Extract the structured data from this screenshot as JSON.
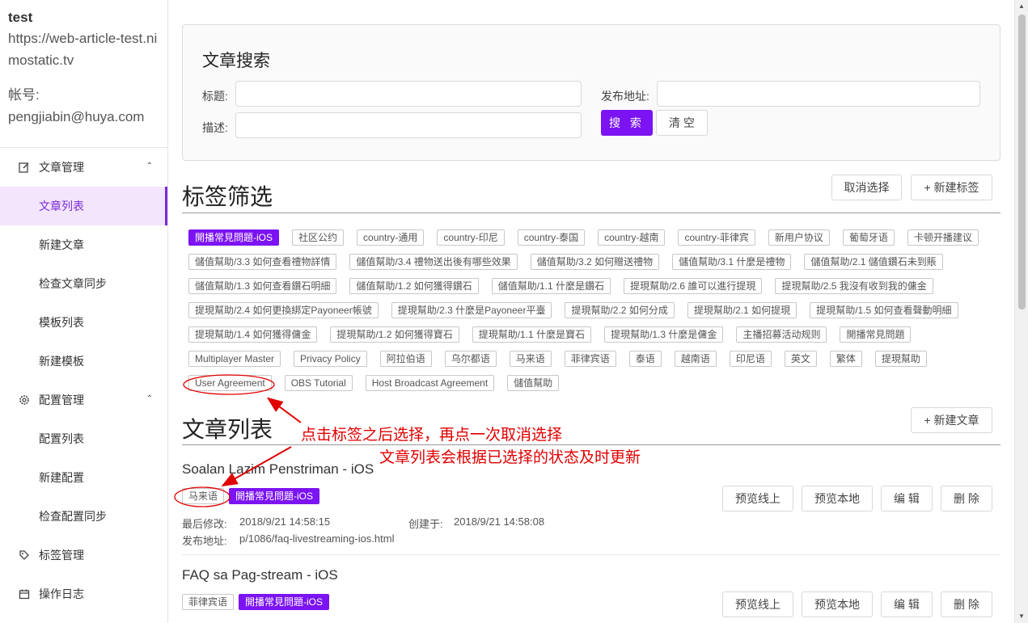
{
  "site": {
    "name": "test",
    "url": "https://web-article-test.nimostatic.tv",
    "account_label": "帐号:",
    "account_email": "pengjiabin@huya.com"
  },
  "menu": {
    "group1": "文章管理",
    "group1_items": [
      "文章列表",
      "新建文章",
      "检查文章同步",
      "模板列表",
      "新建模板"
    ],
    "group2": "配置管理",
    "group2_items": [
      "配置列表",
      "新建配置",
      "检查配置同步"
    ],
    "tags": "标签管理",
    "logs": "操作日志"
  },
  "search": {
    "title": "文章搜索",
    "title_label": "标题:",
    "desc_label": "描述:",
    "address_label": "发布地址:",
    "search_button": "搜 索",
    "clear_button": "清 空"
  },
  "tag_filter": {
    "title": "标签筛选",
    "cancel_button": "取消选择",
    "new_tag_button": "+ 新建标签",
    "rows": [
      [
        "開播常見問題-iOS",
        "社区公约",
        "country-通用",
        "country-印尼",
        "country-泰国",
        "country-越南",
        "country-菲律宾",
        "新用户协议",
        "葡萄牙语",
        "卡顿开播建议"
      ],
      [
        "儲值幫助/3.3 如何查看禮物詳情",
        "儲值幫助/3.4 禮物送出後有哪些效果",
        "儲值幫助/3.2 如何贈送禮物",
        "儲值幫助/3.1 什麼是禮物",
        "儲值幫助/2.1 儲值鑽石未到賬"
      ],
      [
        "儲值幫助/1.3 如何查看鑽石明細",
        "儲值幫助/1.2 如何獲得鑽石",
        "儲值幫助/1.1 什麼是鑽石",
        "提現幫助/2.6 誰可以進行提現",
        "提現幫助/2.5 我沒有收到我的傭金"
      ],
      [
        "提現幫助/2.4 如何更換綁定Payoneer帳號",
        "提現幫助/2.3 什麼是Payoneer平臺",
        "提現幫助/2.2 如何分成",
        "提現幫助/2.1 如何提現",
        "提現幫助/1.5 如何查看聲動明細"
      ],
      [
        "提現幫助/1.4 如何獲得傭金",
        "提現幫助/1.2 如何獲得寶石",
        "提現幫助/1.1 什麼是寶石",
        "提現幫助/1.3 什麼是傭金",
        "主播招募活动规则",
        "開播常見問題"
      ],
      [
        "Multiplayer Master",
        "Privacy Policy",
        "阿拉伯语",
        "乌尔都语",
        "马来语",
        "菲律宾语",
        "泰语",
        "越南语",
        "印尼语",
        "英文",
        "繁体",
        "提現幫助"
      ],
      [
        "User Agreement",
        "OBS Tutorial",
        "Host Broadcast Agreement",
        "儲值幫助"
      ]
    ],
    "selected": "開播常見問題-iOS"
  },
  "article_list": {
    "title": "文章列表",
    "new_article_button": "+ 新建文章",
    "actions": [
      "预览线上",
      "预览本地",
      "编 辑",
      "删 除"
    ],
    "articles": [
      {
        "title": "Soalan Lazim Penstriman - iOS",
        "tags": [
          "马来语",
          "開播常見問題-iOS"
        ],
        "modified_label": "最后修改:",
        "modified": "2018/9/21 14:58:15",
        "created_label": "创建于:",
        "created": "2018/9/21 14:58:08",
        "address_label": "发布地址:",
        "address": "p/1086/faq-livestreaming-ios.html"
      },
      {
        "title": "FAQ sa Pag-stream - iOS",
        "tags": [
          "菲律宾语",
          "開播常見問題-iOS"
        ]
      }
    ]
  },
  "annotations": {
    "line1": "点击标签之后选择，再点一次取消选择",
    "line2": "文章列表会根据已选择的状态及时更新",
    "color": "#e00000"
  },
  "theme": {
    "accent": "#7b13f2"
  }
}
